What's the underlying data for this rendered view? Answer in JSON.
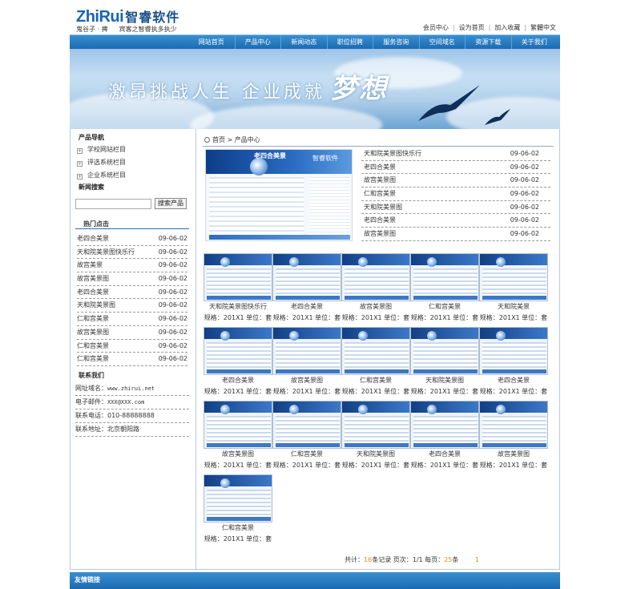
{
  "header": {
    "logo_en": "ZhiRui",
    "logo_cn": "智睿软件",
    "tagline_1": "鬼谷子 · 捭",
    "tagline_2": "宾客之智睿执多执少",
    "toplinks": [
      "会员中心",
      "设为首页",
      "加入收藏",
      "繁體中文"
    ]
  },
  "nav": {
    "items": [
      "网站首页",
      "产品中心",
      "新闻动态",
      "职位招聘",
      "服务咨询",
      "空间域名",
      "资源下载",
      "关于我们"
    ]
  },
  "banner": {
    "text": "激昂挑战人生  企业成就",
    "big": "梦想"
  },
  "sidebar": {
    "product_nav_title": "产品导航",
    "tree": [
      {
        "sign": "+",
        "label": "学校网站栏目"
      },
      {
        "sign": "+",
        "label": "评选系统栏目"
      },
      {
        "sign": "+",
        "label": "企业系统栏目"
      }
    ],
    "news_search_title": "新闻搜索",
    "search_placeholder": "",
    "search_button": "搜索产品",
    "hot_title": "热门点击",
    "hot_items": [
      {
        "title": "老四合美景",
        "date": "09-06-02"
      },
      {
        "title": "天和院美景图快乐行",
        "date": "09-06-02"
      },
      {
        "title": "故宫美景",
        "date": "09-06-02"
      },
      {
        "title": "故宫美景图",
        "date": "09-06-02"
      },
      {
        "title": "老四合美景",
        "date": "09-06-02"
      },
      {
        "title": "天和院美景图",
        "date": "09-06-02"
      },
      {
        "title": "仁和宫美景",
        "date": "09-06-02"
      },
      {
        "title": "故宫美景图",
        "date": "09-06-02"
      },
      {
        "title": "仁和宫美景",
        "date": "09-06-02"
      },
      {
        "title": "仁和宫美景",
        "date": "09-06-02"
      }
    ],
    "contact_title": "联系我们",
    "contact": [
      {
        "label": "网址域名：",
        "value": "www.zhirui.net"
      },
      {
        "label": "电子邮件：",
        "value": "XXX@XXX.com"
      },
      {
        "label": "联系电话：",
        "value": "010-88888888"
      },
      {
        "label": "联系地址：",
        "value": "北京朝阳路"
      }
    ]
  },
  "main": {
    "breadcrumb": "首页 > 产品中心",
    "feature": {
      "title": "老四合美景",
      "brand": "智睿软件"
    },
    "right_list": [
      {
        "title": "天和院美景图快乐行",
        "date": "09-06-02"
      },
      {
        "title": "老四合美景",
        "date": "09-06-02"
      },
      {
        "title": "故宫美景图",
        "date": "09-06-02"
      },
      {
        "title": "仁和宫美景",
        "date": "09-06-02"
      },
      {
        "title": "天和院美景图",
        "date": "09-06-02"
      },
      {
        "title": "老四合美景",
        "date": "09-06-02"
      },
      {
        "title": "故宫美景图",
        "date": "09-06-02"
      }
    ],
    "products": [
      {
        "name": "天和院美景图快乐行",
        "spec": "规格：201X1  单位：套"
      },
      {
        "name": "老四合美景",
        "spec": "规格：201X1  单位：套"
      },
      {
        "name": "故宫美景图",
        "spec": "规格：201X1  单位：套"
      },
      {
        "name": "仁和宫美景",
        "spec": "规格：201X1  单位：套"
      },
      {
        "name": "天和院美景",
        "spec": "规格：201X1  单位：套"
      },
      {
        "name": "老四合美景",
        "spec": "规格：201X1  单位：套"
      },
      {
        "name": "故宫美景图",
        "spec": "规格：201X1  单位：套"
      },
      {
        "name": "仁和宫美景",
        "spec": "规格：201X1  单位：套"
      },
      {
        "name": "天和院美景图",
        "spec": "规格：201X1  单位：套"
      },
      {
        "name": "老四合美景",
        "spec": "规格：201X1  单位：套"
      },
      {
        "name": "故宫美景图",
        "spec": "规格：201X1  单位：套"
      },
      {
        "name": "仁和宫美景",
        "spec": "规格：201X1  单位：套"
      },
      {
        "name": "天和院美景图",
        "spec": "规格：201X1  单位：套"
      },
      {
        "name": "老四合美景",
        "spec": "规格：201X1  单位：套"
      },
      {
        "name": "故宫美景图",
        "spec": "规格：201X1  单位：套"
      },
      {
        "name": "仁和宫美景",
        "spec": "规格：201X1  单位：套"
      }
    ],
    "pager": {
      "total_prefix": "共计：",
      "total": "16",
      "total_suffix": "条记录  页次：",
      "pages": "1/1",
      "per_page_prefix": "  每页：",
      "per_page": "25",
      "per_page_suffix": "条",
      "current": "1"
    }
  },
  "footer": {
    "links_title": "友情链接"
  }
}
